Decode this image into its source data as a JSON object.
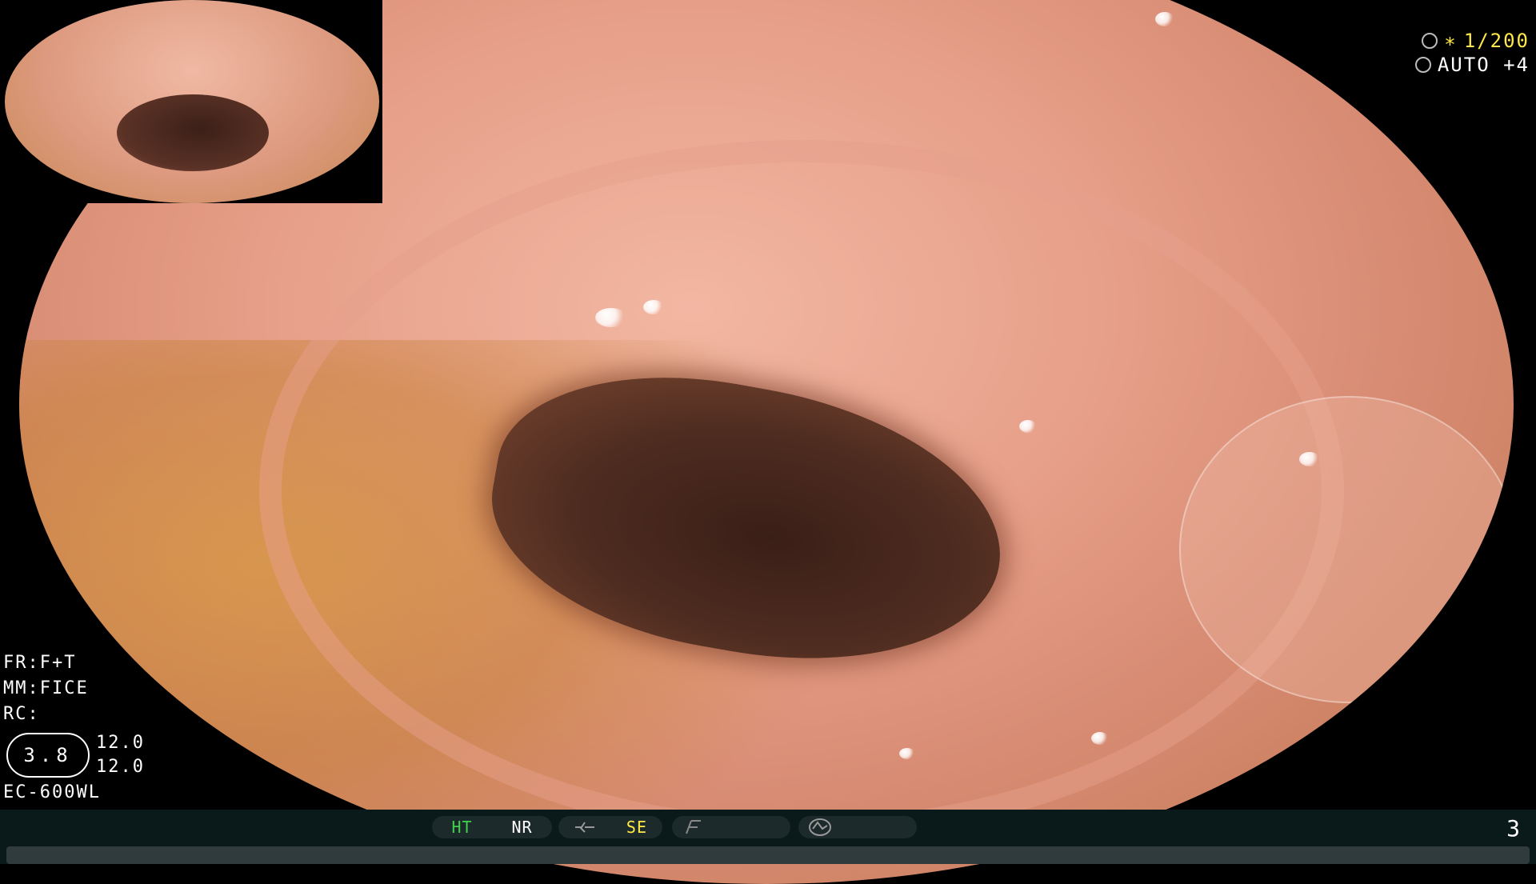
{
  "overlay": {
    "shutter_speed": "1/200",
    "shutter_mark": "∗",
    "iris_mode": "AUTO +4",
    "left_info": [
      "FR:F+T",
      "MM:FICE",
      "RC:"
    ],
    "color_enhance_level": "3.8",
    "color_enhance_values": [
      "12.0",
      "12.0"
    ],
    "scope_model": "EC-600WL",
    "page_number": "3"
  },
  "bottom_bar": {
    "ht": "HT",
    "nr": "NR",
    "se": "SE",
    "icons": [
      "structure-icon",
      "frequency-icon",
      "contrast-icon"
    ]
  },
  "colors": {
    "accent_green": "#3fd24b",
    "accent_yellow": "#ffe84a",
    "bar_bg": "#0a1a1a"
  }
}
